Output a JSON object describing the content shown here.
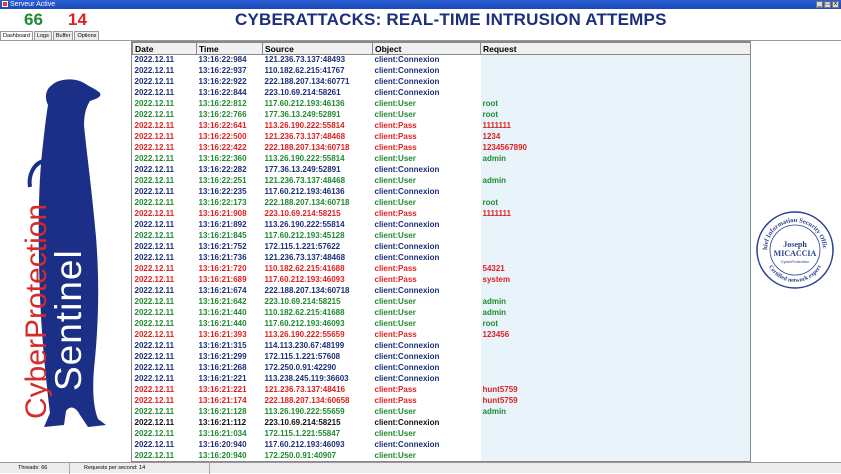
{
  "window": {
    "title": "Serveur Active"
  },
  "header": {
    "count_green": "66",
    "count_red": "14",
    "title": "CYBERATTACKS: REAL-TIME INTRUSION ATTEMPS"
  },
  "tabs": [
    "Dashboard",
    "Logs",
    "Buffer",
    "Options"
  ],
  "logo": {
    "word1": "CyberProtection",
    "word2": "Sentinel",
    "colors": {
      "navy": "#1c2f86",
      "red": "#d42a2a"
    }
  },
  "table": {
    "headers": [
      "Date",
      "Time",
      "Source",
      "Object",
      "Request"
    ],
    "rows": [
      {
        "color": "navy",
        "date": "2022.12.11",
        "time": "13:16:22:984",
        "source": "121.236.73.137:48493",
        "object": "client:Connexion",
        "request": ""
      },
      {
        "color": "navy",
        "date": "2022.12.11",
        "time": "13:16:22:937",
        "source": "110.182.62.215:41767",
        "object": "client:Connexion",
        "request": ""
      },
      {
        "color": "navy",
        "date": "2022.12.11",
        "time": "13:16:22:922",
        "source": "222.188.207.134:60771",
        "object": "client:Connexion",
        "request": ""
      },
      {
        "color": "navy",
        "date": "2022.12.11",
        "time": "13:16:22:844",
        "source": "223.10.69.214:58261",
        "object": "client:Connexion",
        "request": ""
      },
      {
        "color": "green",
        "date": "2022.12.11",
        "time": "13:16:22:812",
        "source": "117.60.212.193:46136",
        "object": "client:User",
        "request": "root"
      },
      {
        "color": "green",
        "date": "2022.12.11",
        "time": "13:16:22:766",
        "source": "177.36.13.249:52891",
        "object": "client:User",
        "request": "root"
      },
      {
        "color": "red",
        "date": "2022.12.11",
        "time": "13:16:22:641",
        "source": "113.26.190.222:55814",
        "object": "client:Pass",
        "request": "1111111"
      },
      {
        "color": "red",
        "date": "2022.12.11",
        "time": "13:16:22:500",
        "source": "121.236.73.137:48468",
        "object": "client:Pass",
        "request": "1234"
      },
      {
        "color": "red",
        "date": "2022.12.11",
        "time": "13:16:22:422",
        "source": "222.188.207.134:60718",
        "object": "client:Pass",
        "request": "1234567890"
      },
      {
        "color": "green",
        "date": "2022.12.11",
        "time": "13:16:22:360",
        "source": "113.26.190.222:55814",
        "object": "client:User",
        "request": "admin"
      },
      {
        "color": "navy",
        "date": "2022.12.11",
        "time": "13:16:22:282",
        "source": "177.36.13.249:52891",
        "object": "client:Connexion",
        "request": ""
      },
      {
        "color": "green",
        "date": "2022.12.11",
        "time": "13:16:22:251",
        "source": "121.236.73.137:48468",
        "object": "client:User",
        "request": "admin"
      },
      {
        "color": "navy",
        "date": "2022.12.11",
        "time": "13:16:22:235",
        "source": "117.60.212.193:46136",
        "object": "client:Connexion",
        "request": ""
      },
      {
        "color": "green",
        "date": "2022.12.11",
        "time": "13:16:22:173",
        "source": "222.188.207.134:60718",
        "object": "client:User",
        "request": "root"
      },
      {
        "color": "red",
        "date": "2022.12.11",
        "time": "13:16:21:908",
        "source": "223.10.69.214:58215",
        "object": "client:Pass",
        "request": "1111111"
      },
      {
        "color": "navy",
        "date": "2022.12.11",
        "time": "13:16:21:892",
        "source": "113.26.190.222:55814",
        "object": "client:Connexion",
        "request": ""
      },
      {
        "color": "green",
        "date": "2022.12.11",
        "time": "13:16:21:845",
        "source": "117.60.212.193:45128",
        "object": "client:User",
        "request": ""
      },
      {
        "color": "navy",
        "date": "2022.12.11",
        "time": "13:16:21:752",
        "source": "172.115.1.221:57622",
        "object": "client:Connexion",
        "request": ""
      },
      {
        "color": "navy",
        "date": "2022.12.11",
        "time": "13:16:21:736",
        "source": "121.236.73.137:48468",
        "object": "client:Connexion",
        "request": ""
      },
      {
        "color": "red",
        "date": "2022.12.11",
        "time": "13:16:21:720",
        "source": "110.182.62.215:41688",
        "object": "client:Pass",
        "request": "54321"
      },
      {
        "color": "red",
        "date": "2022.12.11",
        "time": "13:16:21:689",
        "source": "117.60.212.193:46093",
        "object": "client:Pass",
        "request": "system"
      },
      {
        "color": "navy",
        "date": "2022.12.11",
        "time": "13:16:21:674",
        "source": "222.188.207.134:60718",
        "object": "client:Connexion",
        "request": ""
      },
      {
        "color": "green",
        "date": "2022.12.11",
        "time": "13:16:21:642",
        "source": "223.10.69.214:58215",
        "object": "client:User",
        "request": "admin"
      },
      {
        "color": "green",
        "date": "2022.12.11",
        "time": "13:16:21:440",
        "source": "110.182.62.215:41688",
        "object": "client:User",
        "request": "admin"
      },
      {
        "color": "green",
        "date": "2022.12.11",
        "time": "13:16:21:440",
        "source": "117.60.212.193:46093",
        "object": "client:User",
        "request": "root"
      },
      {
        "color": "red",
        "date": "2022.12.11",
        "time": "13:16:21:393",
        "source": "113.26.190.222:55659",
        "object": "client:Pass",
        "request": "123456"
      },
      {
        "color": "navy",
        "date": "2022.12.11",
        "time": "13:16:21:315",
        "source": "114.113.230.67:48199",
        "object": "client:Connexion",
        "request": ""
      },
      {
        "color": "navy",
        "date": "2022.12.11",
        "time": "13:16:21:299",
        "source": "172.115.1.221:57608",
        "object": "client:Connexion",
        "request": ""
      },
      {
        "color": "navy",
        "date": "2022.12.11",
        "time": "13:16:21:268",
        "source": "172.250.0.91:42290",
        "object": "client:Connexion",
        "request": ""
      },
      {
        "color": "navy",
        "date": "2022.12.11",
        "time": "13:16:21:221",
        "source": "113.238.245.119:36603",
        "object": "client:Connexion",
        "request": ""
      },
      {
        "color": "red",
        "date": "2022.12.11",
        "time": "13:16:21:221",
        "source": "121.236.73.137:48416",
        "object": "client:Pass",
        "request": "hunt5759"
      },
      {
        "color": "red",
        "date": "2022.12.11",
        "time": "13:16:21:174",
        "source": "222.188.207.134:60658",
        "object": "client:Pass",
        "request": "hunt5759"
      },
      {
        "color": "green",
        "date": "2022.12.11",
        "time": "13:16:21:128",
        "source": "113.26.190.222:55659",
        "object": "client:User",
        "request": "admin"
      },
      {
        "color": "black",
        "date": "2022.12.11",
        "time": "13:16:21:112",
        "source": "223.10.69.214:58215",
        "object": "client:Connexion",
        "request": ""
      },
      {
        "color": "green",
        "date": "2022.12.11",
        "time": "13:16:21:034",
        "source": "172.115.1.221:55847",
        "object": "client:User",
        "request": ""
      },
      {
        "color": "navy",
        "date": "2022.12.11",
        "time": "13:16:20:940",
        "source": "117.60.212.193:46093",
        "object": "client:Connexion",
        "request": ""
      },
      {
        "color": "green",
        "date": "2022.12.11",
        "time": "13:16:20:940",
        "source": "172.250.0.91:40907",
        "object": "client:User",
        "request": ""
      }
    ]
  },
  "stamp": {
    "name1": "Joseph",
    "name2": "MICACCIA",
    "ring_top": "Chief Information Security Officer",
    "ring_bottom": "Certified network expert",
    "sub": "CyberProtection"
  },
  "status": {
    "threads": "Threads: 66",
    "rps": "Requests per second: 14"
  }
}
